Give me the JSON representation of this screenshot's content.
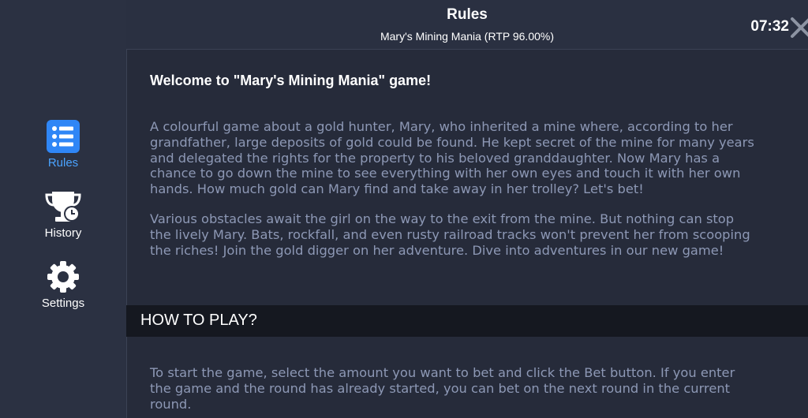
{
  "header": {
    "title": "Rules",
    "subtitle": "Mary's Mining Mania (RTP 96.00%)",
    "clock": "07:32",
    "close_icon": "close-icon"
  },
  "sidebar": {
    "items": [
      {
        "label": "Rules",
        "icon": "list-icon",
        "active": true
      },
      {
        "label": "History",
        "icon": "trophy-clock-icon",
        "active": false
      },
      {
        "label": "Settings",
        "icon": "gear-icon",
        "active": false
      }
    ]
  },
  "content": {
    "welcome": "Welcome to \"Mary's Mining Mania\" game!",
    "intro_lines": [
      "A colourful game about a gold hunter, Mary, who inherited a mine where, according to her",
      "grandfather, large deposits of gold could be found. He kept secret of the mine for many years",
      "and delegated the rights for the property to his beloved granddaughter. Now Mary has a",
      "chance to go down the mine to see everything with her own eyes and touch it with her own",
      "hands. How much gold can Mary find and take away in her trolley? Let's bet!"
    ],
    "obstacles_lines": [
      "Various obstacles await the girl on the way to the exit from the mine. But nothing can stop",
      "the lively Mary. Bats, rockfall, and even rusty railroad tracks won't prevent her from scooping",
      "the riches! Join the gold digger on her adventure. Dive into adventures in our new game!"
    ],
    "how_to_play_title": "HOW TO PLAY?",
    "how_to_play_lines": [
      "To start the game, select the amount you want to bet and click the Bet button. If you enter",
      "the game and the round has already started, you can bet on the next round in the current",
      "round."
    ]
  },
  "colors": {
    "accent": "#4aa3ff",
    "background": "#262b3a",
    "sidebar": "#2b3142",
    "body_text": "#8d98b5",
    "section_bar": "#151820"
  }
}
